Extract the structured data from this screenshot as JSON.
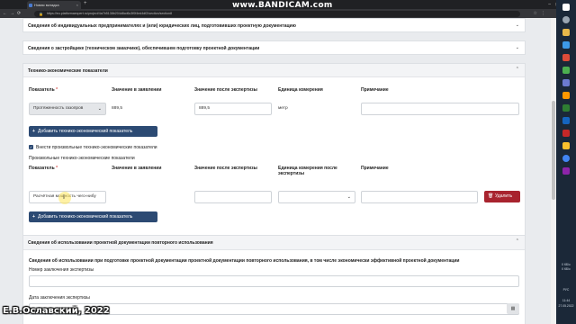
{
  "browser": {
    "tab_title": "Новая вкладка",
    "url": "https://eu.platformaexpert.ru/project/4a7b5138b204d8cd6c3f0f4ed4df2/section/section8",
    "recorder_watermark": "www.BANDICAM.com"
  },
  "sections": {
    "individuals": "Сведения об индивидуальных предпринимателях и (или) юридических лиц, подготовивших проектную документацию",
    "developer": "Сведения о застройщике (техническом заказчике), обеспечившем подготовку проектной документации",
    "tep": "Технико-экономические показатели",
    "reuse": "Сведения об использовании проектной документации повторного использования"
  },
  "tep_table": {
    "headers": {
      "indicator": "Показатель",
      "in_application": "Значение в заявлении",
      "after_expertise": "Значение после экспертизы",
      "unit": "Единица измерения",
      "note": "Примечание"
    },
    "row": {
      "indicator": "Протяженность газопров",
      "in_application": "889,5",
      "after_expertise": "889,5",
      "unit": "метр",
      "note": ""
    },
    "add_button": "Добавить технико-экономический показатель"
  },
  "custom": {
    "checkbox_label": "Внести произвольные технико-экономические показатели",
    "title": "Произвольные технико-экономические показатели",
    "headers": {
      "indicator": "Показатель",
      "in_application": "Значение в заявлении",
      "after_expertise": "Значение после экспертизы",
      "unit": "Единица измерения после экспертизы",
      "note": "Примечание"
    },
    "row": {
      "indicator": "Расчётная мощность чего-нибу",
      "in_application": "",
      "after_expertise": "",
      "unit": "",
      "note": ""
    },
    "delete_button": "Удалить",
    "add_button": "Добавить технико-экономический показатель"
  },
  "reuse": {
    "question": "Сведения об использовании при подготовке проектной документации проектной документации повторного использования, в том числе экономически эффективной проектной документации",
    "expertise_number_label": "Номер заключения экспертизы",
    "expertise_date_label": "Дата заключения экспертизы"
  },
  "taskbar": {
    "net_up": "0 КБ/с",
    "net_down": "0 КБ/с",
    "lang": "РУС",
    "time": "11:44",
    "date": "27.05.2022"
  },
  "author_watermark": "Е.В.Ославский, 2022",
  "colors": {
    "primary": "#2c4a73",
    "danger": "#a8232e",
    "required": "#d9534f"
  }
}
